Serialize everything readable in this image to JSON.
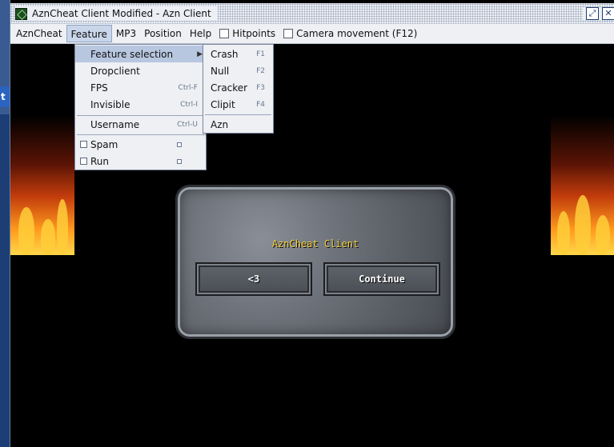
{
  "window": {
    "title": "AznCheat Client Modified - Azn Client",
    "controls": [
      "restore",
      "close"
    ]
  },
  "desktop": {
    "edge_label": "t"
  },
  "menubar": {
    "items": [
      {
        "label": "AznCheat"
      },
      {
        "label": "Feature",
        "open": true
      },
      {
        "label": "MP3"
      },
      {
        "label": "Position"
      },
      {
        "label": "Help"
      }
    ],
    "checkboxes": [
      {
        "label": "Hitpoints",
        "checked": false
      },
      {
        "label": "Camera movement (F12)",
        "checked": false
      }
    ]
  },
  "feature_menu": {
    "items": [
      {
        "label": "Feature selection",
        "submenu": true,
        "highlighted": true
      },
      {
        "label": "Dropclient"
      },
      {
        "label": "FPS",
        "accel": "Ctrl-F"
      },
      {
        "label": "Invisible",
        "accel": "Ctrl-I"
      },
      {
        "label": "Username",
        "accel": "Ctrl-U"
      },
      {
        "label": "Spam",
        "checkbox": true
      },
      {
        "label": "Run",
        "checkbox": true
      }
    ]
  },
  "feature_submenu": {
    "items": [
      {
        "label": "Crash",
        "accel": "F1"
      },
      {
        "label": "Null",
        "accel": "F2"
      },
      {
        "label": "Cracker",
        "accel": "F3"
      },
      {
        "label": "Clipit",
        "accel": "F4"
      },
      {
        "label": "Azn"
      }
    ]
  },
  "dialog": {
    "title": "AznCheat Client",
    "buttons": [
      {
        "label": "<3"
      },
      {
        "label": "Continue"
      }
    ]
  },
  "colors": {
    "dialog_title": "#f5d23a",
    "menu_highlight": "#b8c7e0",
    "desktop": "#3a5a92"
  }
}
